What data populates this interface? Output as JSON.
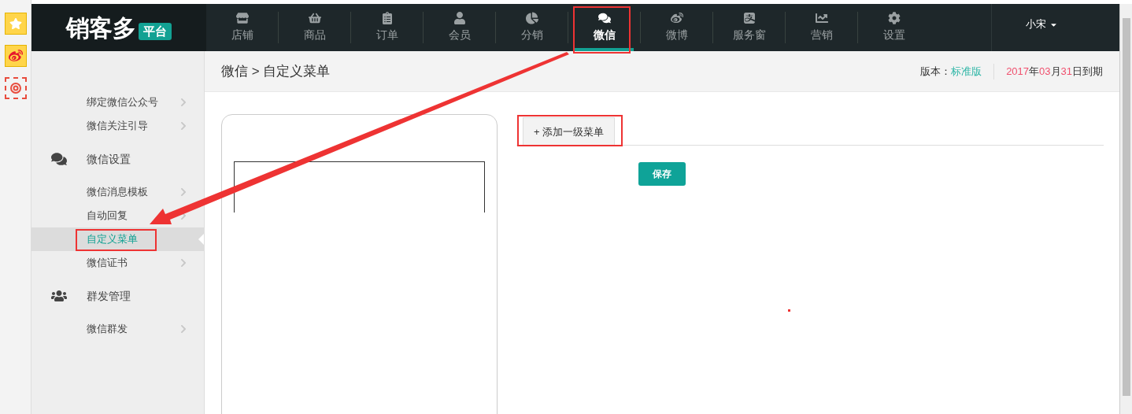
{
  "logo": {
    "name": "销客多",
    "badge": "平台"
  },
  "nav": [
    {
      "label": "店铺",
      "selected": false
    },
    {
      "label": "商品",
      "selected": false
    },
    {
      "label": "订单",
      "selected": false
    },
    {
      "label": "会员",
      "selected": false
    },
    {
      "label": "分销",
      "selected": false
    },
    {
      "label": "微信",
      "selected": true
    },
    {
      "label": "微博",
      "selected": false
    },
    {
      "label": "服务窗",
      "selected": false
    },
    {
      "label": "营销",
      "selected": false
    },
    {
      "label": "设置",
      "selected": false
    }
  ],
  "user": "小宋",
  "sidebar": [
    {
      "kind": "link",
      "label": "绑定微信公众号",
      "selected": false
    },
    {
      "kind": "link",
      "label": "微信关注引导",
      "selected": false
    },
    {
      "kind": "group",
      "label": "微信设置",
      "selected": false
    },
    {
      "kind": "link",
      "label": "微信消息模板",
      "selected": false
    },
    {
      "kind": "link",
      "label": "自动回复",
      "selected": false
    },
    {
      "kind": "link",
      "label": "自定义菜单",
      "selected": true
    },
    {
      "kind": "link",
      "label": "微信证书",
      "selected": false
    },
    {
      "kind": "group",
      "label": "群发管理",
      "selected": false
    },
    {
      "kind": "link",
      "label": "微信群发",
      "selected": false
    }
  ],
  "breadcrumb": "微信 > 自定义菜单",
  "version": {
    "label": "版本：",
    "value": "标准版"
  },
  "expiry": [
    {
      "kind": "number",
      "text": "2017"
    },
    {
      "kind": "text",
      "text": "年"
    },
    {
      "kind": "number",
      "text": "03"
    },
    {
      "kind": "text",
      "text": "月"
    },
    {
      "kind": "number",
      "text": "31"
    },
    {
      "kind": "text",
      "text": "日到期"
    }
  ],
  "menu_tab": "+ 添加一级菜单",
  "save_button": "保存"
}
